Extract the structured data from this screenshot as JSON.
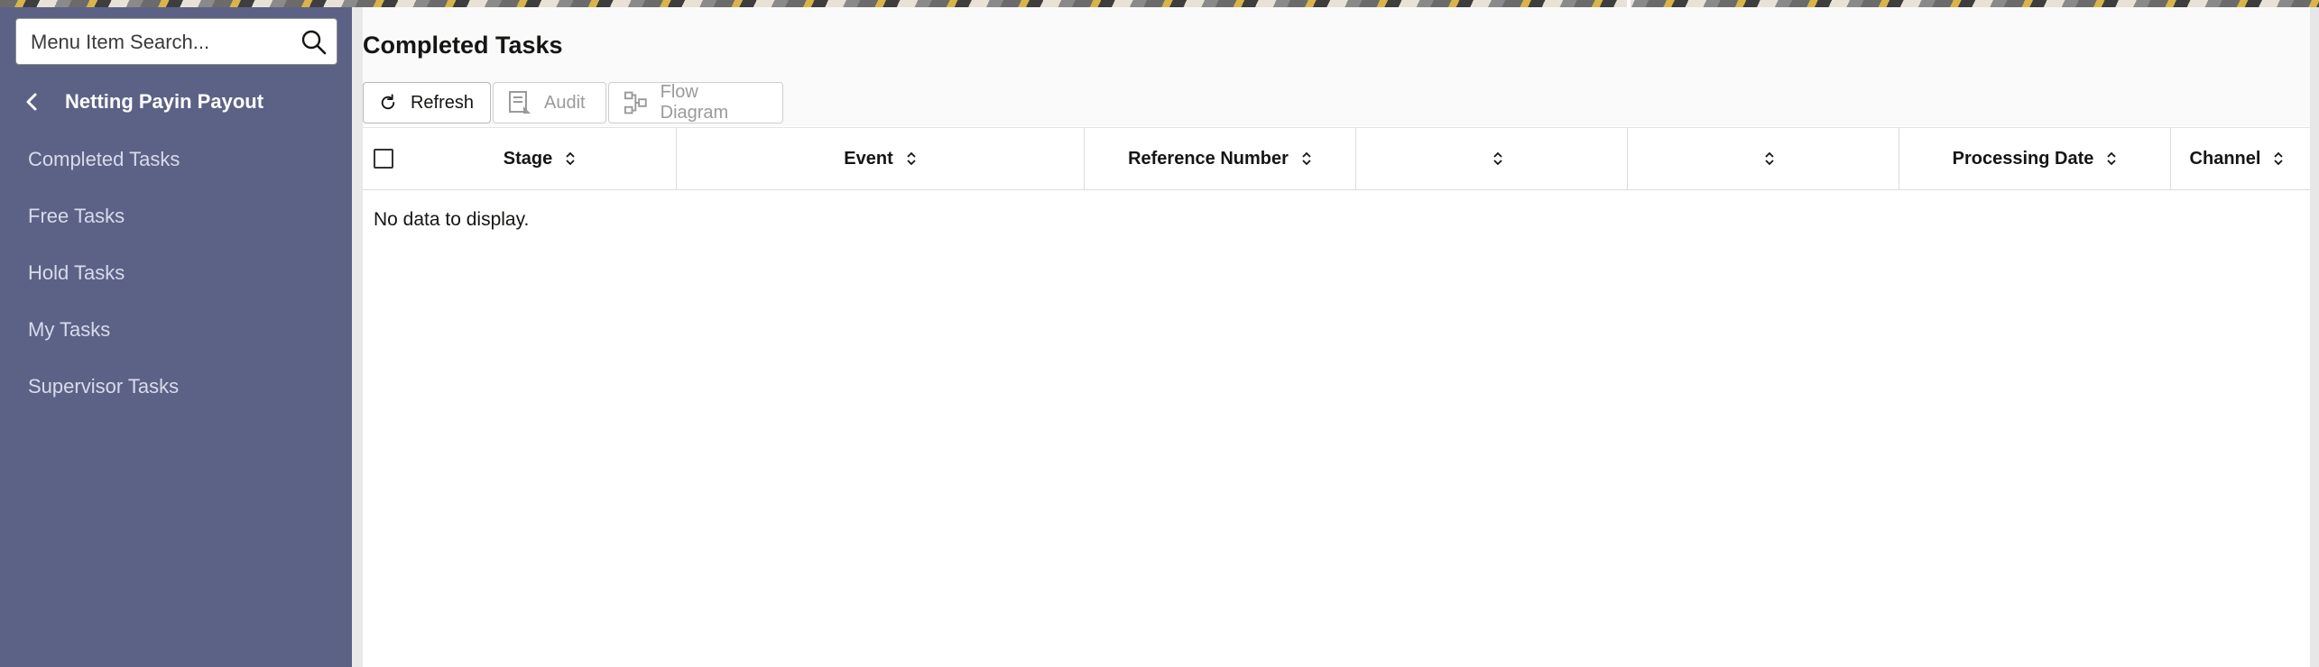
{
  "sidebar": {
    "search_placeholder": "Menu Item Search...",
    "section_title": "Netting Payin Payout",
    "items": [
      {
        "label": "Completed Tasks"
      },
      {
        "label": "Free Tasks"
      },
      {
        "label": "Hold Tasks"
      },
      {
        "label": "My Tasks"
      },
      {
        "label": "Supervisor Tasks"
      }
    ]
  },
  "main": {
    "title": "Completed Tasks",
    "toolbar": {
      "refresh": "Refresh",
      "audit": "Audit",
      "flow_diagram": "Flow Diagram"
    },
    "table": {
      "columns": [
        "Stage",
        "Event",
        "Reference Number",
        "",
        "",
        "Processing Date",
        "Channel"
      ],
      "empty_message": "No data to display."
    }
  },
  "colors": {
    "sidebar_bg": "#5c6286",
    "sidebar_text": "#d8dbeb",
    "accent_text": "#161513"
  }
}
